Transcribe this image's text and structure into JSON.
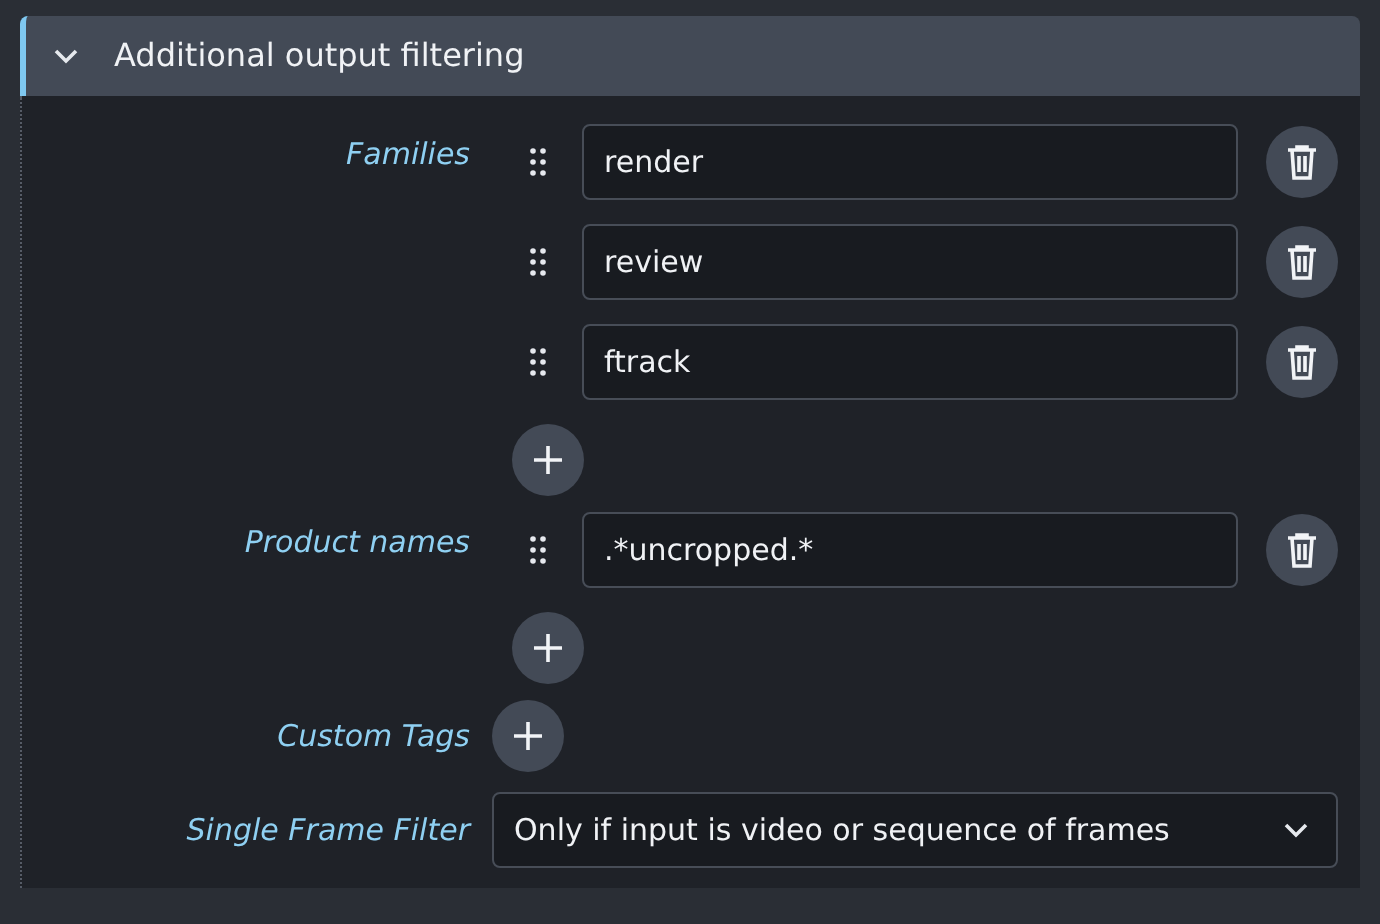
{
  "section": {
    "title": "Additional output filtering",
    "expanded": true
  },
  "fields": [
    {
      "kind": "list",
      "label": "Families",
      "items": [
        "render",
        "review",
        "ftrack"
      ]
    },
    {
      "kind": "list",
      "label": "Product names",
      "items": [
        ".*uncropped.*"
      ]
    },
    {
      "kind": "list",
      "label": "Custom Tags"
    },
    {
      "kind": "select",
      "label": "Single Frame Filter",
      "value": "Only if input is video or sequence of frames"
    }
  ]
}
